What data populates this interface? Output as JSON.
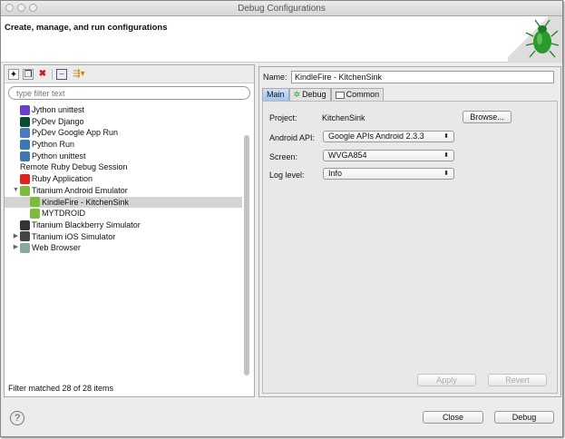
{
  "window": {
    "title": "Debug Configurations"
  },
  "header": {
    "subtitle": "Create, manage, and run configurations"
  },
  "left": {
    "filter_placeholder": "type filter text",
    "items": [
      {
        "label": "Jython unittest",
        "icon": "jython-unittest-icon",
        "indent": 1
      },
      {
        "label": "PyDev Django",
        "icon": "django-icon",
        "indent": 1
      },
      {
        "label": "PyDev Google App Run",
        "icon": "google-app-icon",
        "indent": 1
      },
      {
        "label": "Python Run",
        "icon": "python-icon",
        "indent": 1
      },
      {
        "label": "Python unittest",
        "icon": "python-unittest-icon",
        "indent": 1
      },
      {
        "label": "Remote Ruby Debug Session",
        "icon": "",
        "indent": 1
      },
      {
        "label": "Ruby Application",
        "icon": "ruby-icon",
        "indent": 1
      },
      {
        "label": "Titanium Android Emulator",
        "icon": "android-icon",
        "indent": 0,
        "twisty": "expanded"
      },
      {
        "label": "KindleFire - KitchenSink",
        "icon": "android-icon",
        "indent": 2,
        "selected": true
      },
      {
        "label": "MYTDROID",
        "icon": "android-icon",
        "indent": 2
      },
      {
        "label": "Titanium Blackberry Simulator",
        "icon": "blackberry-icon",
        "indent": 1
      },
      {
        "label": "Titanium iOS Simulator",
        "icon": "apple-icon",
        "indent": 0,
        "twisty": "collapsed"
      },
      {
        "label": "Web Browser",
        "icon": "web-browser-icon",
        "indent": 0,
        "twisty": "collapsed"
      }
    ],
    "status": "Filter matched 28 of 28 items"
  },
  "right": {
    "name_label": "Name:",
    "name_value": "KindleFire - KitchenSink",
    "tabs": [
      "Main",
      "Debug",
      "Common"
    ],
    "project_label": "Project:",
    "project_value": "KitchenSink",
    "browse": "Browse...",
    "api_label": "Android API:",
    "api_value": "Google APIs Android 2.3.3",
    "screen_label": "Screen:",
    "screen_value": "WVGA854",
    "log_label": "Log level:",
    "log_value": "Info",
    "apply": "Apply",
    "revert": "Revert"
  },
  "footer": {
    "help": "?",
    "close": "Close",
    "debug": "Debug"
  }
}
